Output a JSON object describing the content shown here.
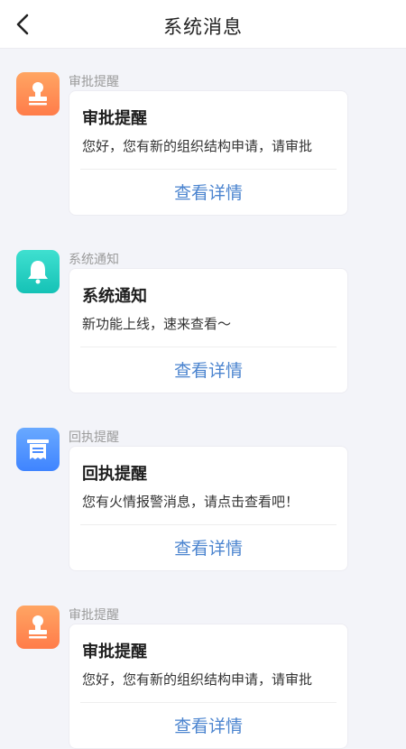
{
  "header": {
    "title": "系统消息",
    "back_icon": "chevron-left-icon"
  },
  "messages": [
    {
      "category": "审批提醒",
      "icon": "stamp-icon",
      "color": "#ff8a50",
      "title": "审批提醒",
      "body": "您好，您有新的组织结构申请，请审批",
      "action": "查看详情"
    },
    {
      "category": "系统通知",
      "icon": "bell-icon",
      "color": "#1ec9bb",
      "title": "系统通知",
      "body": "新功能上线，速来查看～",
      "action": "查看详情"
    },
    {
      "category": "回执提醒",
      "icon": "receipt-icon",
      "color": "#4a8dff",
      "title": "回执提醒",
      "body": "您有火情报警消息，请点击查看吧！",
      "action": "查看详情"
    },
    {
      "category": "审批提醒",
      "icon": "stamp-icon",
      "color": "#ff8a50",
      "title": "审批提醒",
      "body": "您好，您有新的组织结构申请，请审批",
      "action": "查看详情"
    }
  ]
}
